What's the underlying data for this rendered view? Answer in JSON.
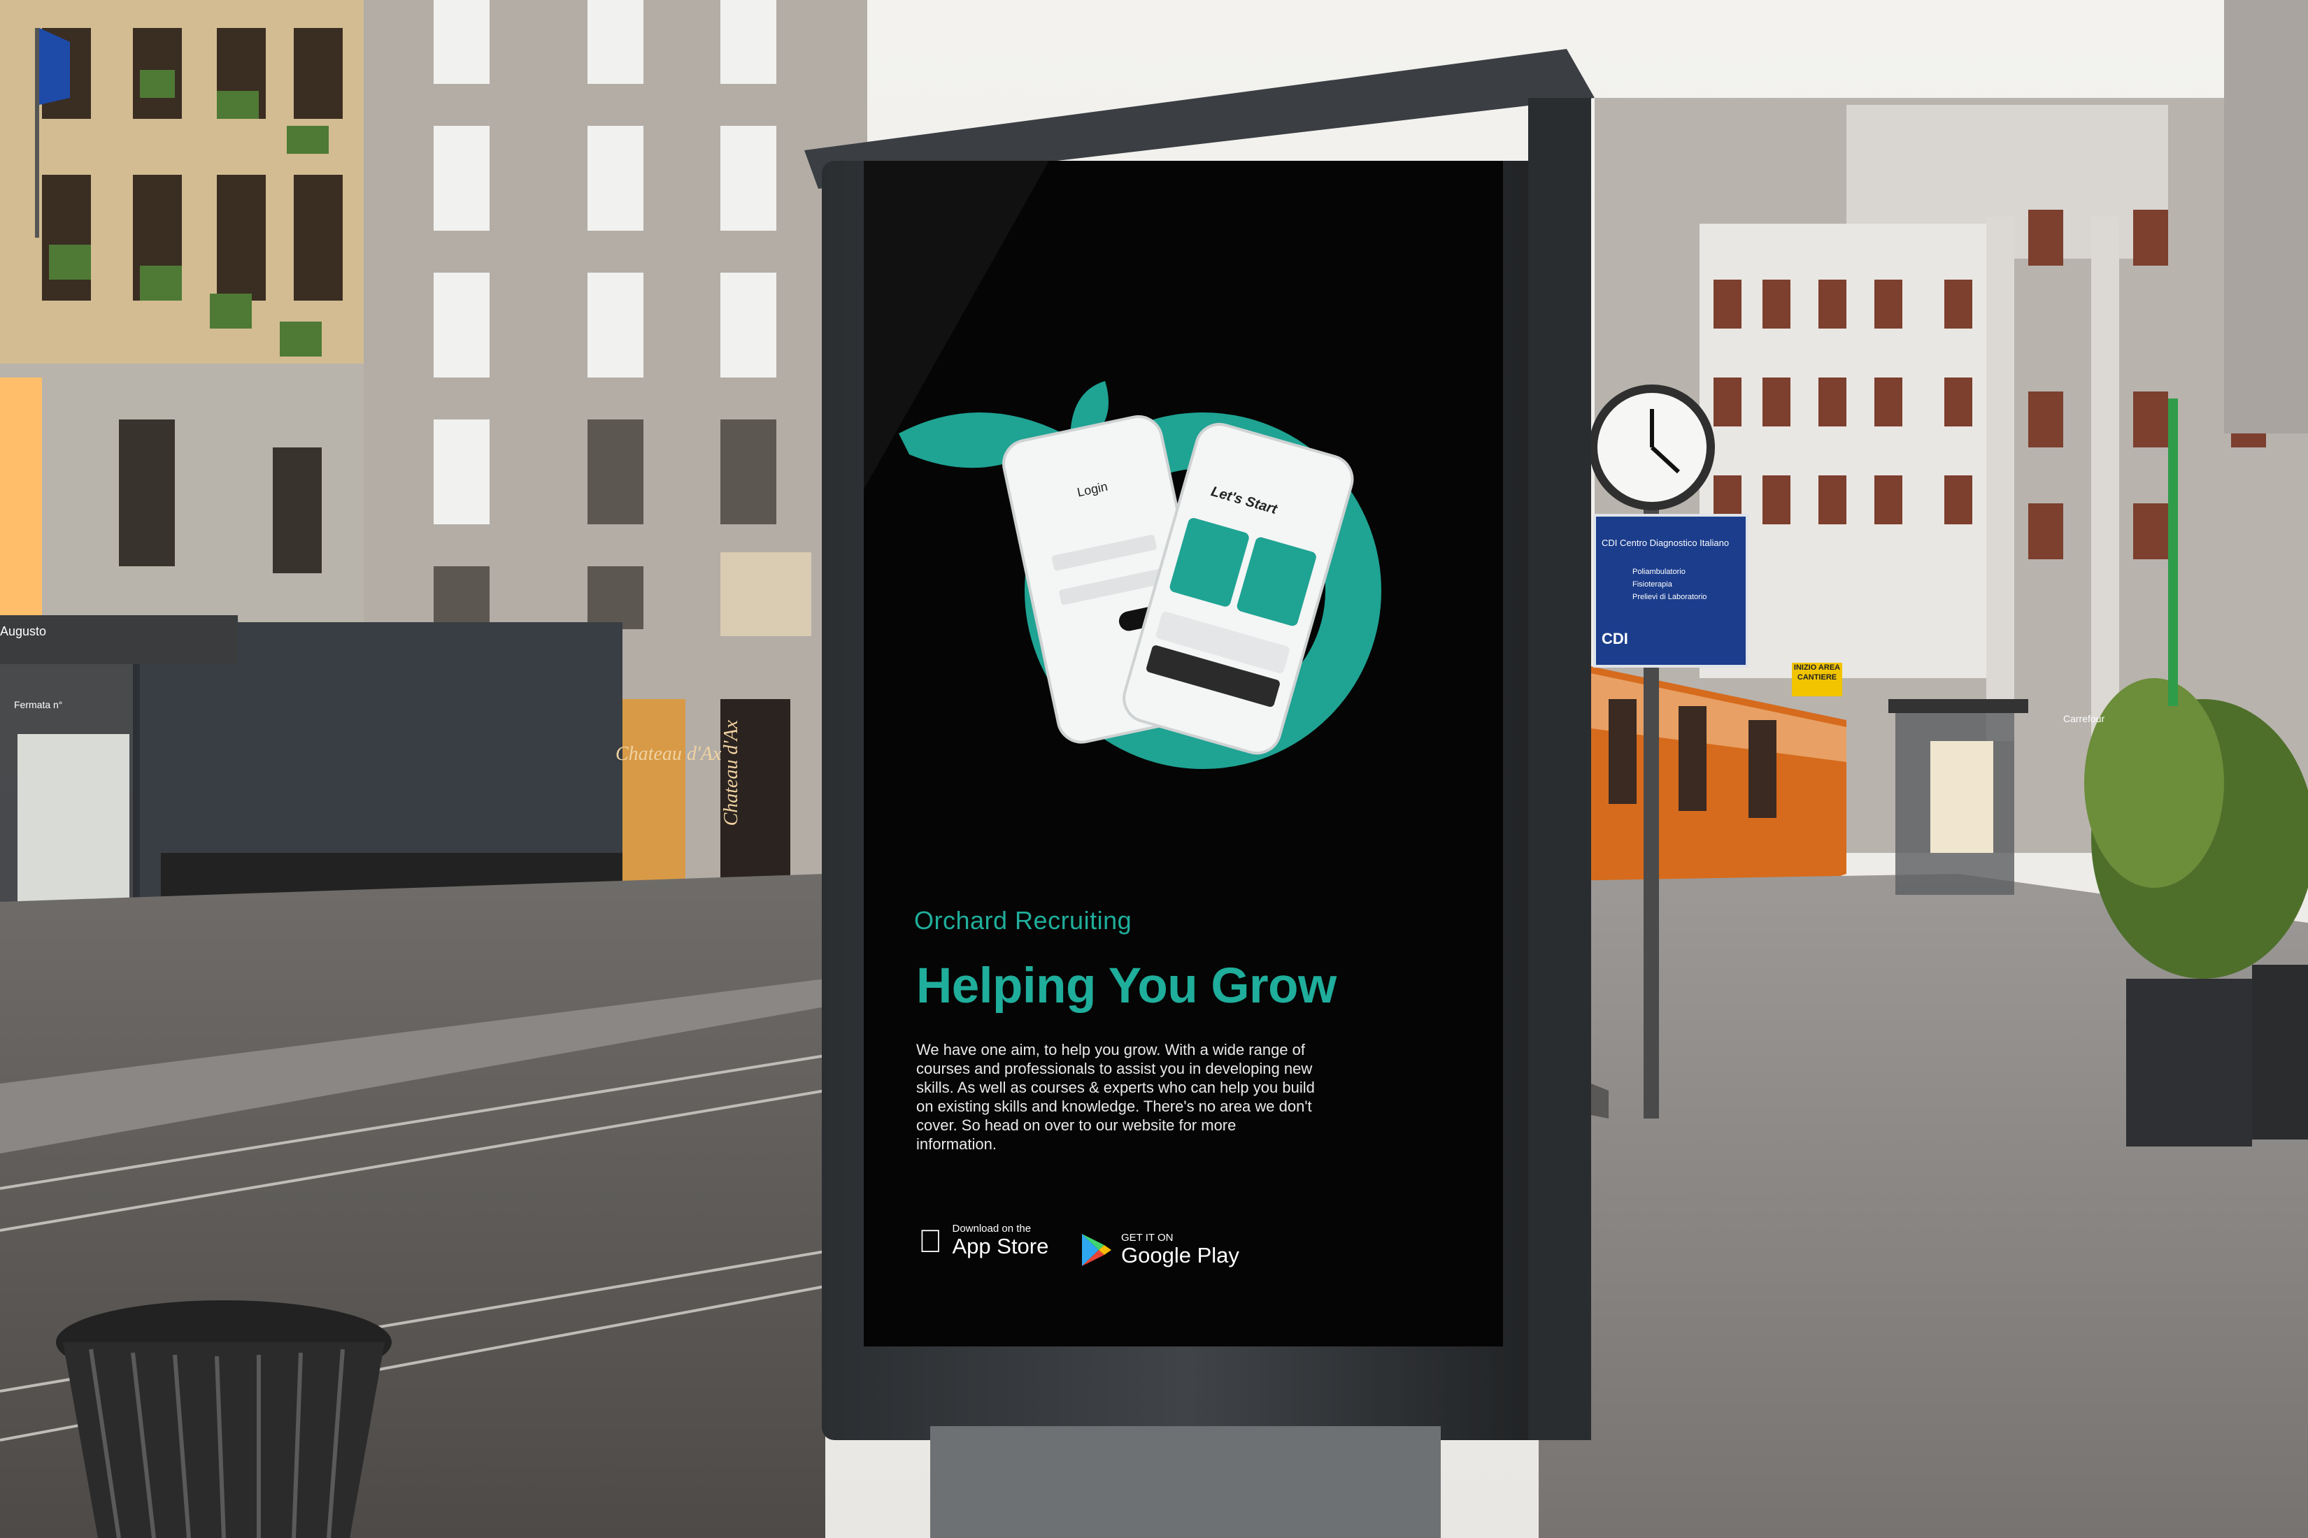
{
  "poster": {
    "brand": "Orchard Recruiting",
    "headline": "Helping You Grow",
    "body": "We have one aim, to help you grow. With a wide range of courses and professionals to assist you in developing new skills. As well as courses & experts who can help you build on existing skills and knowledge. There's no area we don't cover. So head on over to our website for more information.",
    "app_store_small": "Download on the",
    "app_store_big": "App Store",
    "google_play_small": "GET IT ON",
    "google_play_big": "Google Play",
    "login_title": "Login",
    "lets_start_title": "Let's Start",
    "accent_color": "#1fae9b",
    "icons": [
      "apple-icon",
      "google-play-icon",
      "leaf-logo-icon"
    ]
  },
  "street": {
    "stop_sign_title": "CDI Centro Diagnostico Italiano",
    "stop_sign_lines": [
      "Poliambulatorio",
      "Fisioterapia",
      "Prelievi di Laboratorio"
    ],
    "stop_sign_brand": "CDI",
    "shelter_name": "Augusto",
    "stop_placard": "Fermata n°",
    "shop_sign_1": "Chateau d'Ax",
    "shop_sign_2": "Chateau d'Ax",
    "info_sign": "INIZIO AREA CANTIERE",
    "cafe_sign": "Carrefour"
  }
}
